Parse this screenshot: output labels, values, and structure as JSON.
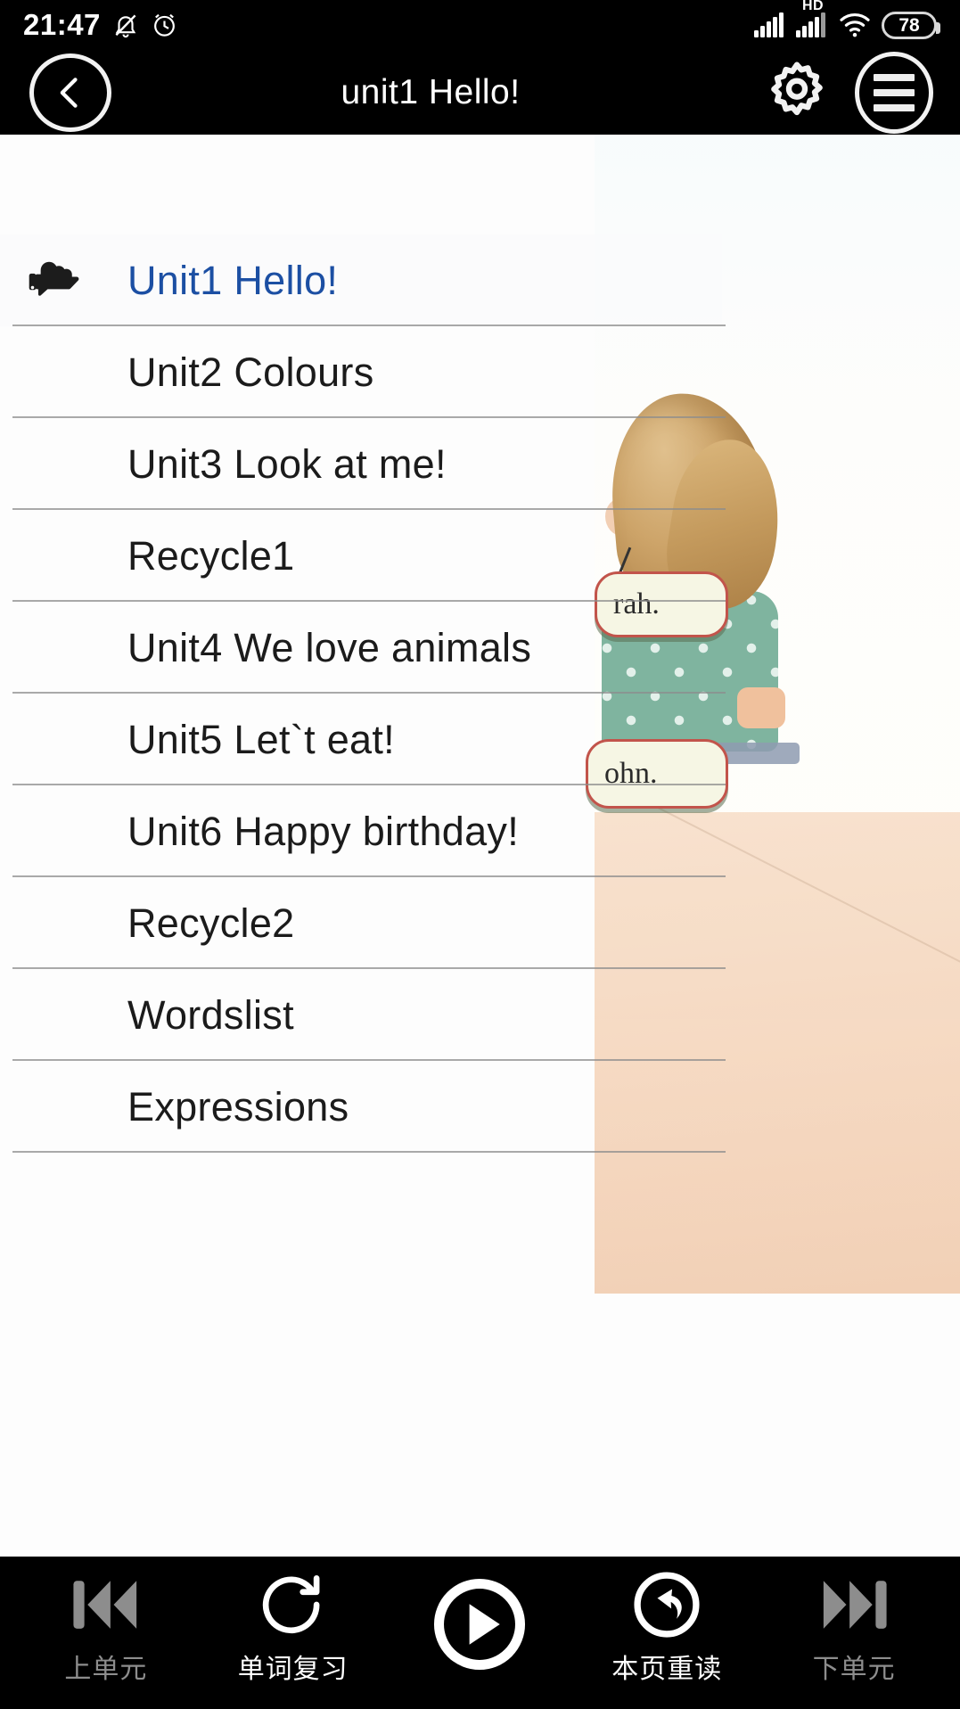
{
  "status_bar": {
    "time": "21:47",
    "icons": [
      "mute-bell-icon",
      "alarm-clock-icon",
      "signal-bars-icon",
      "hd-icon",
      "signal-bars-2-icon",
      "wifi-icon"
    ],
    "hd_label": "HD",
    "battery_level": "78"
  },
  "header": {
    "back_icon": "chevron-left-icon",
    "title": "unit1  Hello!",
    "settings_icon": "gear-icon",
    "menu_icon": "hamburger-menu-icon"
  },
  "unit_list": {
    "selected_index": 0,
    "pointer_icon": "pointing-hand-icon",
    "items": [
      {
        "label": "Unit1   Hello!"
      },
      {
        "label": "Unit2   Colours"
      },
      {
        "label": "Unit3   Look at me!"
      },
      {
        "label": "Recycle1"
      },
      {
        "label": "Unit4   We love animals"
      },
      {
        "label": "Unit5   Let`t eat!"
      },
      {
        "label": "Unit6   Happy birthday!"
      },
      {
        "label": "Recycle2"
      },
      {
        "label": "Wordslist"
      },
      {
        "label": "Expressions"
      }
    ]
  },
  "background_art": {
    "speech_bubble_1": "rah.",
    "speech_bubble_2": "ohn."
  },
  "bottom_bar": {
    "items": [
      {
        "label": "上单元",
        "icon": "skip-previous-icon",
        "dim": true
      },
      {
        "label": "单词复习",
        "icon": "refresh-circle-icon",
        "dim": false
      },
      {
        "label": "",
        "icon": "play-circle-icon",
        "dim": false
      },
      {
        "label": "本页重读",
        "icon": "replay-back-icon",
        "dim": false
      },
      {
        "label": "下单元",
        "icon": "skip-next-icon",
        "dim": true
      }
    ]
  },
  "colors": {
    "accent_blue": "#1c4fa3",
    "bar_black": "#000000",
    "text_dark": "#1b1b1b",
    "dim_gray": "#8d8d8d"
  }
}
